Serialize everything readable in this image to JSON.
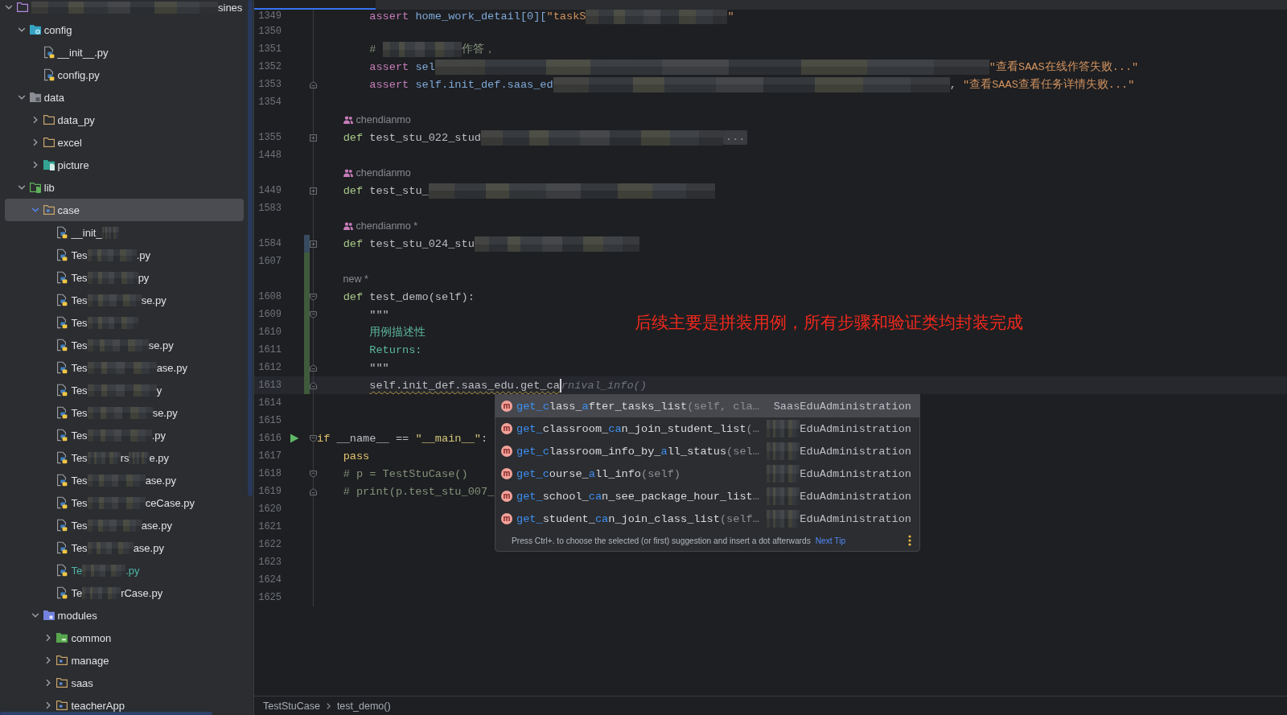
{
  "project_tree": {
    "items": [
      {
        "kind": "project",
        "parts": [
          {
            "kind": "blur"
          },
          {
            "kind": "text",
            "text": "sines"
          }
        ],
        "expanded": true,
        "selected": false,
        "children": [
          {
            "kind": "settings",
            "label": "config",
            "expanded": true,
            "selected": false,
            "children": [
              {
                "kind": "python",
                "label": "__init__.py",
                "selected": false
              },
              {
                "kind": "python",
                "label": "config.py",
                "selected": false
              }
            ]
          },
          {
            "kind": "excluded",
            "label": "data",
            "expanded": true,
            "selected": false,
            "children": [
              {
                "kind": "folder",
                "label": "data_py",
                "expanded": false,
                "selected": false
              },
              {
                "kind": "folder",
                "label": "excel",
                "expanded": false,
                "selected": false
              },
              {
                "kind": "resources",
                "label": "picture",
                "expanded": false,
                "selected": false
              }
            ]
          },
          {
            "kind": "sources",
            "label": "lib",
            "expanded": true,
            "selected": false,
            "children": [
              {
                "kind": "package",
                "label": "case",
                "expanded": true,
                "selected": true,
                "children": [
                  {
                    "kind": "python",
                    "parts": [
                      {
                        "kind": "text",
                        "text": "__init_"
                      },
                      {
                        "kind": "blur"
                      }
                    ],
                    "selected": false
                  },
                  {
                    "kind": "python",
                    "parts": [
                      {
                        "kind": "text",
                        "text": "Tes"
                      },
                      {
                        "kind": "blur"
                      },
                      {
                        "kind": "text",
                        "text": ".py"
                      }
                    ],
                    "selected": false
                  },
                  {
                    "kind": "python",
                    "parts": [
                      {
                        "kind": "text",
                        "text": "Tes"
                      },
                      {
                        "kind": "blur"
                      },
                      {
                        "kind": "text",
                        "text": "py"
                      }
                    ],
                    "selected": false
                  },
                  {
                    "kind": "python",
                    "parts": [
                      {
                        "kind": "text",
                        "text": "Tes"
                      },
                      {
                        "kind": "blur"
                      },
                      {
                        "kind": "text",
                        "text": "se.py"
                      }
                    ],
                    "selected": false
                  },
                  {
                    "kind": "python",
                    "parts": [
                      {
                        "kind": "text",
                        "text": "Tes"
                      },
                      {
                        "kind": "blur"
                      }
                    ],
                    "selected": false
                  },
                  {
                    "kind": "python",
                    "parts": [
                      {
                        "kind": "text",
                        "text": "Tes"
                      },
                      {
                        "kind": "blur"
                      },
                      {
                        "kind": "text",
                        "text": "se.py"
                      }
                    ],
                    "selected": false
                  },
                  {
                    "kind": "python",
                    "parts": [
                      {
                        "kind": "text",
                        "text": "Tes"
                      },
                      {
                        "kind": "blur"
                      },
                      {
                        "kind": "text",
                        "text": "ase.py"
                      }
                    ],
                    "selected": false
                  },
                  {
                    "kind": "python",
                    "parts": [
                      {
                        "kind": "text",
                        "text": "Tes"
                      },
                      {
                        "kind": "blur"
                      },
                      {
                        "kind": "text",
                        "text": "y"
                      }
                    ],
                    "selected": false
                  },
                  {
                    "kind": "python",
                    "parts": [
                      {
                        "kind": "text",
                        "text": "Tes"
                      },
                      {
                        "kind": "blur"
                      },
                      {
                        "kind": "text",
                        "text": "se.py"
                      }
                    ],
                    "selected": false
                  },
                  {
                    "kind": "python",
                    "parts": [
                      {
                        "kind": "text",
                        "text": "Tes"
                      },
                      {
                        "kind": "blur"
                      },
                      {
                        "kind": "text",
                        "text": ".py"
                      }
                    ],
                    "selected": false
                  },
                  {
                    "kind": "python",
                    "parts": [
                      {
                        "kind": "text",
                        "text": "Tes"
                      },
                      {
                        "kind": "blur"
                      },
                      {
                        "kind": "text",
                        "text": "rs"
                      },
                      {
                        "kind": "blur"
                      },
                      {
                        "kind": "text",
                        "text": "e.py"
                      }
                    ],
                    "selected": false
                  },
                  {
                    "kind": "python",
                    "parts": [
                      {
                        "kind": "text",
                        "text": "Tes"
                      },
                      {
                        "kind": "blur"
                      },
                      {
                        "kind": "text",
                        "text": "ase.py"
                      }
                    ],
                    "selected": false
                  },
                  {
                    "kind": "python",
                    "parts": [
                      {
                        "kind": "text",
                        "text": "Tes"
                      },
                      {
                        "kind": "blur"
                      },
                      {
                        "kind": "text",
                        "text": "ceCase.py"
                      }
                    ],
                    "selected": false
                  },
                  {
                    "kind": "python",
                    "parts": [
                      {
                        "kind": "text",
                        "text": "Tes"
                      },
                      {
                        "kind": "blur"
                      },
                      {
                        "kind": "text",
                        "text": "ase.py"
                      }
                    ],
                    "selected": false
                  },
                  {
                    "kind": "python",
                    "parts": [
                      {
                        "kind": "text",
                        "text": "Tes"
                      },
                      {
                        "kind": "blur"
                      },
                      {
                        "kind": "text",
                        "text": "ase.py"
                      }
                    ],
                    "selected": false
                  },
                  {
                    "kind": "python",
                    "parts": [
                      {
                        "kind": "text",
                        "text": "Te"
                      },
                      {
                        "kind": "blur"
                      },
                      {
                        "kind": "text",
                        "text": ".py"
                      }
                    ],
                    "selected": false,
                    "color": "#4fb5a8"
                  },
                  {
                    "kind": "python",
                    "parts": [
                      {
                        "kind": "text",
                        "text": "Te"
                      },
                      {
                        "kind": "blur"
                      },
                      {
                        "kind": "text",
                        "text": "rCase.py"
                      }
                    ],
                    "selected": false
                  }
                ]
              },
              {
                "kind": "module",
                "label": "modules",
                "expanded": true,
                "selected": false,
                "children": [
                  {
                    "kind": "tests",
                    "label": "common",
                    "expanded": false,
                    "selected": false
                  },
                  {
                    "kind": "package",
                    "label": "manage",
                    "expanded": false,
                    "selected": false
                  },
                  {
                    "kind": "package",
                    "label": "saas",
                    "expanded": false,
                    "selected": false
                  },
                  {
                    "kind": "package",
                    "label": "teacherApp",
                    "expanded": false,
                    "selected": false
                  }
                ]
              }
            ]
          }
        ]
      }
    ]
  },
  "editor": {
    "lines": [
      {
        "kind": "code",
        "number": "1349",
        "tokens": [
          {
            "kind": "keyword",
            "text": "        assert"
          },
          {
            "kind": "ref",
            "text": " home_work_detail[0]["
          },
          {
            "kind": "string",
            "text": "\"taskS"
          },
          {
            "kind": "blur"
          },
          {
            "kind": "string",
            "text": "\""
          }
        ]
      },
      {
        "kind": "code",
        "number": "1350"
      },
      {
        "kind": "code",
        "number": "1351",
        "tokens": [
          {
            "kind": "comment",
            "text": "        # "
          },
          {
            "kind": "blur"
          },
          {
            "kind": "comment",
            "text": "作答，"
          }
        ]
      },
      {
        "kind": "code",
        "number": "1352",
        "tokens": [
          {
            "kind": "keyword",
            "text": "        assert"
          },
          {
            "kind": "ref",
            "text": " sel"
          },
          {
            "kind": "blur"
          },
          {
            "kind": "string",
            "text": "\"查看SAAS在线作答失败...\""
          }
        ]
      },
      {
        "kind": "code",
        "number": "1353",
        "fold": {
          "kind": "end"
        },
        "tokens": [
          {
            "kind": "keyword",
            "text": "        assert"
          },
          {
            "kind": "ref",
            "text": " self.init_def.saas_ed"
          },
          {
            "kind": "blur"
          },
          {
            "kind": "text",
            "text": ", "
          },
          {
            "kind": "string",
            "text": "\"查看SAAS查看任务详情失败...\""
          }
        ]
      },
      {
        "kind": "code",
        "number": "1354"
      },
      {
        "kind": "inlay",
        "text": "chendianmo",
        "people_icon": true
      },
      {
        "kind": "code",
        "number": "1355",
        "fold": {
          "kind": "collapsed"
        },
        "tokens": [
          {
            "kind": "def",
            "text": "    def"
          },
          {
            "kind": "text",
            "text": " test_stu_022_stud"
          },
          {
            "kind": "blur"
          },
          {
            "kind": "folded",
            "text": "..."
          }
        ]
      },
      {
        "kind": "code",
        "number": "1448"
      },
      {
        "kind": "inlay",
        "text": "chendianmo",
        "people_icon": true
      },
      {
        "kind": "code",
        "number": "1449",
        "fold": {
          "kind": "collapsed"
        },
        "tokens": [
          {
            "kind": "def",
            "text": "    def"
          },
          {
            "kind": "text",
            "text": " test_stu_"
          },
          {
            "kind": "blur"
          }
        ]
      },
      {
        "kind": "code",
        "number": "1583"
      },
      {
        "kind": "inlay",
        "text": "chendianmo *",
        "people_icon": true
      },
      {
        "kind": "code",
        "number": "1584",
        "fold": {
          "kind": "collapsed"
        },
        "change": {
          "kind": "modified"
        },
        "tokens": [
          {
            "kind": "def",
            "text": "    def"
          },
          {
            "kind": "text",
            "text": " test_stu_024_stu"
          },
          {
            "kind": "blur"
          }
        ]
      },
      {
        "kind": "code",
        "number": "1607",
        "change": {
          "kind": "added"
        }
      },
      {
        "kind": "inlay",
        "text": "new *",
        "people_icon": false,
        "change": {
          "kind": "added"
        }
      },
      {
        "kind": "code",
        "number": "1608",
        "fold": {
          "kind": "start"
        },
        "change": {
          "kind": "added"
        },
        "tokens": [
          {
            "kind": "def",
            "text": "    def"
          },
          {
            "kind": "text",
            "text": " test_demo(self):"
          }
        ]
      },
      {
        "kind": "code",
        "number": "1609",
        "fold": {
          "kind": "start"
        },
        "change": {
          "kind": "added"
        },
        "tokens": [
          {
            "kind": "text",
            "text": "        \"\"\""
          }
        ]
      },
      {
        "kind": "code",
        "number": "1610",
        "change": {
          "kind": "added"
        },
        "tokens": [
          {
            "kind": "doc",
            "text": "        用例描述性"
          }
        ]
      },
      {
        "kind": "code",
        "number": "1611",
        "change": {
          "kind": "added"
        },
        "tokens": [
          {
            "kind": "doc",
            "text": "        Returns:"
          }
        ]
      },
      {
        "kind": "code",
        "number": "1612",
        "fold": {
          "kind": "end"
        },
        "change": {
          "kind": "added"
        },
        "tokens": [
          {
            "kind": "text",
            "text": "        \"\"\""
          }
        ]
      },
      {
        "kind": "code",
        "number": "1613",
        "fold": {
          "kind": "end"
        },
        "change": {
          "kind": "added"
        },
        "current": true,
        "tokens": [
          {
            "kind": "text",
            "text": "        self.init_def.saas_edu.get_ca",
            "warning": true
          },
          {
            "kind": "caret"
          },
          {
            "kind": "hint",
            "text": "rnival_info()"
          }
        ]
      },
      {
        "kind": "code",
        "number": "1614"
      },
      {
        "kind": "code",
        "number": "1615"
      },
      {
        "kind": "code",
        "number": "1616",
        "fold": {
          "kind": "start"
        },
        "run": true,
        "tokens": [
          {
            "kind": "flow",
            "text": "if"
          },
          {
            "kind": "text",
            "text": " __name__ == "
          },
          {
            "kind": "string-alt",
            "text": "\"__main__\""
          },
          {
            "kind": "text",
            "text": ":"
          }
        ]
      },
      {
        "kind": "code",
        "number": "1617",
        "tokens": [
          {
            "kind": "flow",
            "text": "    pass"
          }
        ]
      },
      {
        "kind": "code",
        "number": "1618",
        "fold": {
          "kind": "start"
        },
        "tokens": [
          {
            "kind": "comment",
            "text": "    # p = TestStuCase()"
          }
        ]
      },
      {
        "kind": "code",
        "number": "1619",
        "fold": {
          "kind": "end"
        },
        "tokens": [
          {
            "kind": "comment",
            "text": "    # print(p.test_stu_007_"
          }
        ]
      },
      {
        "kind": "code",
        "number": "1620"
      },
      {
        "kind": "code",
        "number": "1621"
      },
      {
        "kind": "code",
        "number": "1622"
      },
      {
        "kind": "code",
        "number": "1623"
      },
      {
        "kind": "code",
        "number": "1624"
      },
      {
        "kind": "code",
        "number": "1625"
      }
    ],
    "annotation": {
      "text": "后续主要是拼装用例，所有步骤和验证类均封装完成"
    },
    "completion": {
      "items": [
        {
          "symbol": "m",
          "segments": [
            {
              "text": "get_c",
              "matched": true
            },
            {
              "text": "lass_",
              "matched": false
            },
            {
              "text": "a",
              "matched": true
            },
            {
              "text": "fter_tasks_list",
              "matched": false
            }
          ],
          "params": "(self, cla…",
          "type": "SaasEduAdministration",
          "redacted": false,
          "selected": true
        },
        {
          "symbol": "m",
          "segments": [
            {
              "text": "get_",
              "matched": true
            },
            {
              "text": "classroom_",
              "matched": false
            },
            {
              "text": "ca",
              "matched": true
            },
            {
              "text": "n_join_student_list",
              "matched": false
            }
          ],
          "params": "(…",
          "type": "EduAdministration",
          "redacted": true,
          "selected": false
        },
        {
          "symbol": "m",
          "segments": [
            {
              "text": "get_c",
              "matched": true
            },
            {
              "text": "lassroom_info_by_",
              "matched": false
            },
            {
              "text": "a",
              "matched": true
            },
            {
              "text": "ll_status",
              "matched": false
            }
          ],
          "params": "(sel…",
          "type": "EduAdministration",
          "redacted": true,
          "selected": false
        },
        {
          "symbol": "m",
          "segments": [
            {
              "text": "get_c",
              "matched": true
            },
            {
              "text": "ourse_",
              "matched": false
            },
            {
              "text": "a",
              "matched": true
            },
            {
              "text": "ll_info",
              "matched": false
            }
          ],
          "params": "(self)",
          "type": "EduAdministration",
          "redacted": true,
          "selected": false
        },
        {
          "symbol": "m",
          "segments": [
            {
              "text": "get_",
              "matched": true
            },
            {
              "text": "school_",
              "matched": false
            },
            {
              "text": "ca",
              "matched": true
            },
            {
              "text": "n_see_package_hour_list",
              "matched": false
            }
          ],
          "params": "…",
          "type": "EduAdministration",
          "redacted": true,
          "selected": false
        },
        {
          "symbol": "m",
          "segments": [
            {
              "text": "get_",
              "matched": true
            },
            {
              "text": "student_",
              "matched": false
            },
            {
              "text": "ca",
              "matched": true
            },
            {
              "text": "n_join_class_list",
              "matched": false
            }
          ],
          "params": "(self…",
          "type": "EduAdministration",
          "redacted": true,
          "selected": false
        }
      ],
      "tip": "Press Ctrl+. to choose the selected (or first) suggestion and insert a dot afterwards",
      "tip_link": "Next Tip"
    },
    "breadcrumbs": [
      "TestStuCase",
      "test_demo()"
    ]
  }
}
